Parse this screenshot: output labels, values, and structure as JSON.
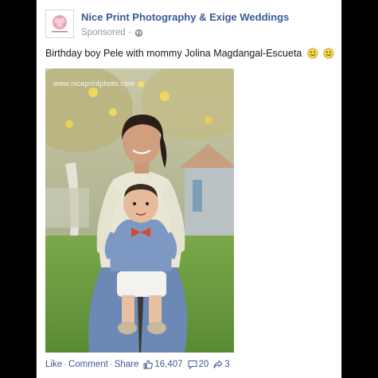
{
  "post": {
    "page_name": "Nice Print Photography & Exige Weddings",
    "sponsored_label": "Sponsored",
    "sponsored_separator": "·",
    "text": "Birthday boy Pele with mommy Jolina Magdangal-Escueta",
    "emoji_count": 2,
    "photo": {
      "watermark": "www.niceprintphoto.com"
    }
  },
  "actions": {
    "like_label": "Like",
    "comment_label": "Comment",
    "share_label": "Share",
    "separator": "·",
    "likes_count": "16,407",
    "comments_count": "20",
    "shares_count": "3"
  },
  "icons": {
    "avatar": "logo-icon",
    "globe": "globe-icon",
    "emoji": "smiley-icon",
    "likes": "thumbs-up-icon",
    "comments": "comment-bubble-icon",
    "shares": "share-arrow-icon"
  },
  "colors": {
    "link_blue": "#3b5998",
    "meta_gray": "#9197a3",
    "text_dark": "#141823",
    "background": "#000000",
    "card": "#ffffff"
  }
}
